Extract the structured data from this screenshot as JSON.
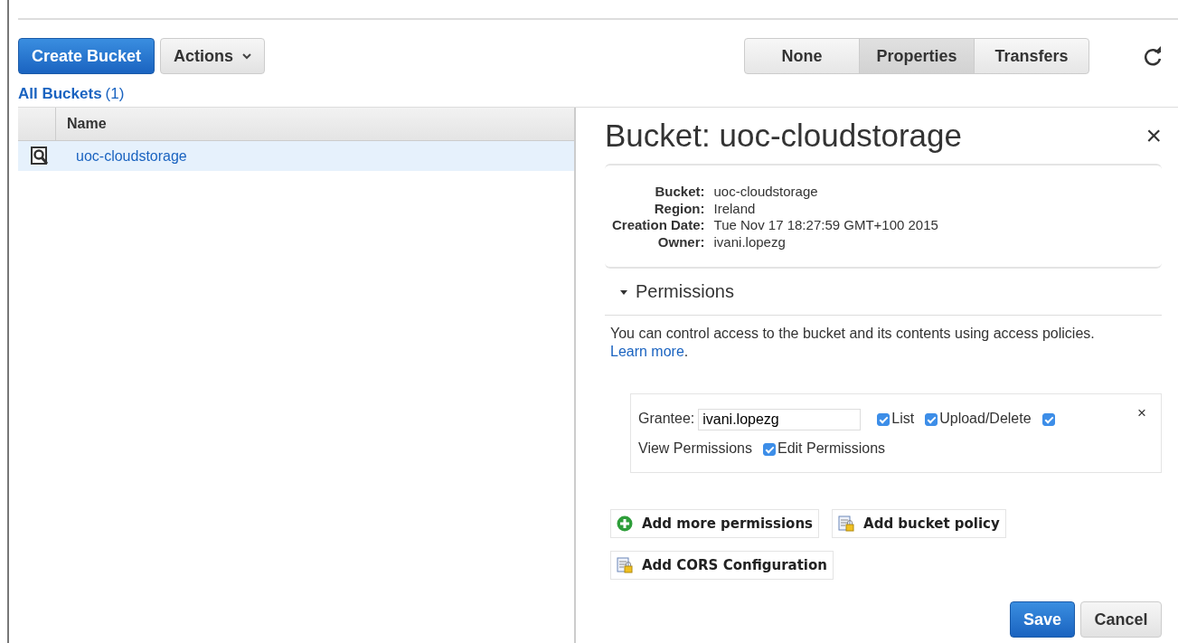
{
  "toolbar": {
    "create_button": "Create Bucket",
    "actions_button": "Actions"
  },
  "view_tabs": [
    {
      "label": "None",
      "selected": false
    },
    {
      "label": "Properties",
      "selected": true
    },
    {
      "label": "Transfers",
      "selected": false
    }
  ],
  "breadcrumb": {
    "label": "All Buckets",
    "count": "(1)"
  },
  "table": {
    "columns": [
      "Name"
    ],
    "rows": [
      {
        "name": "uoc-cloudstorage",
        "selected": true
      }
    ]
  },
  "panel": {
    "title": "Bucket: uoc-cloudstorage",
    "close": "×",
    "properties": [
      {
        "label": "Bucket:",
        "value": "uoc-cloudstorage"
      },
      {
        "label": "Region:",
        "value": "Ireland"
      },
      {
        "label": "Creation Date:",
        "value": "Tue Nov 17 18:27:59 GMT+100 2015"
      },
      {
        "label": "Owner:",
        "value": "ivani.lopezg"
      }
    ],
    "permissions": {
      "title": "Permissions",
      "expanded": true,
      "description": "You can control access to the bucket and its contents using access policies.",
      "link": "Learn more",
      "after_link": ".",
      "grants": [
        {
          "grantee_label": "Grantee:",
          "grantee": "ivani.lopezg",
          "remove": "×",
          "rights": [
            {
              "label": "List",
              "checked": true
            },
            {
              "label": "Upload/Delete",
              "checked": true
            },
            {
              "label": "View Permissions",
              "checked": true
            },
            {
              "label": "Edit Permissions",
              "checked": true
            }
          ]
        }
      ]
    },
    "actions": [
      {
        "label": "Add more permissions",
        "kind": "add"
      },
      {
        "label": "Add bucket policy",
        "kind": "policy"
      },
      {
        "label": "Add CORS Configuration",
        "kind": "policy"
      }
    ],
    "save": "Save",
    "cancel": "Cancel"
  }
}
